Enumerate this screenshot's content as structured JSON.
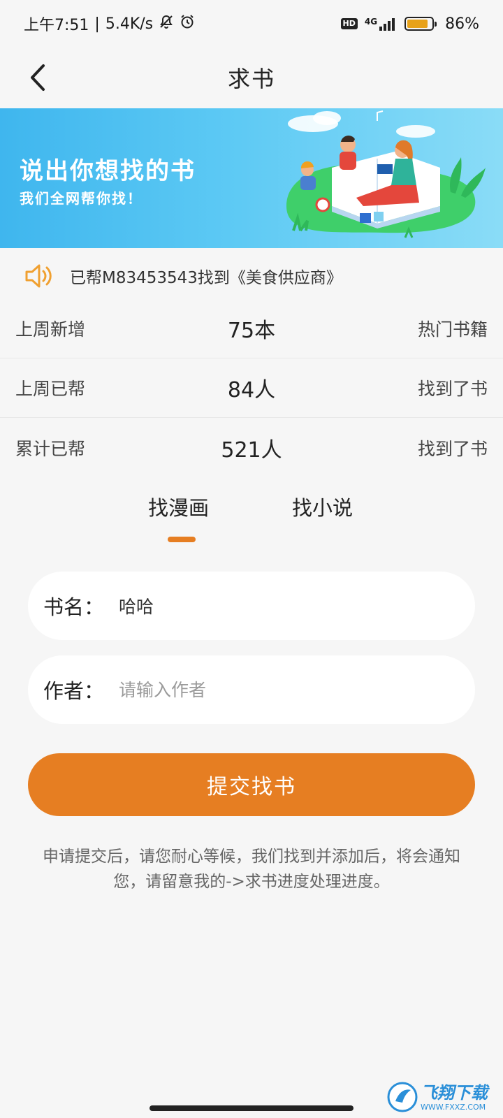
{
  "status_bar": {
    "time": "上午7:51",
    "speed": "5.4K/s",
    "network": "4G",
    "hd": "HD",
    "battery_percent": "86%",
    "battery_level": 0.86
  },
  "header": {
    "title": "求书"
  },
  "banner": {
    "title": "说出你想找的书",
    "subtitle": "我们全网帮你找！"
  },
  "notice": {
    "text": "已帮M83453543找到《美食供应商》"
  },
  "stats": [
    {
      "label": "上周新增",
      "value": "75本",
      "right": "热门书籍"
    },
    {
      "label": "上周已帮",
      "value": "84人",
      "right": "找到了书"
    },
    {
      "label": "累计已帮",
      "value": "521人",
      "right": "找到了书"
    }
  ],
  "tabs": {
    "comic": "找漫画",
    "novel": "找小说",
    "active": "comic"
  },
  "form": {
    "title_label": "书名：",
    "title_value": "哈哈",
    "author_label": "作者：",
    "author_placeholder": "请输入作者",
    "submit_label": "提交找书"
  },
  "hint": "申请提交后，请您耐心等候，我们找到并添加后，将会通知您，请留意我的->求书进度处理进度。",
  "watermark": {
    "brand": "飞翔下载",
    "url": "WWW.FXXZ.COM"
  },
  "colors": {
    "accent": "#e67e22",
    "banner_start": "#3fb6ee",
    "banner_end": "#8adcf7",
    "background": "#f6f6f6"
  }
}
